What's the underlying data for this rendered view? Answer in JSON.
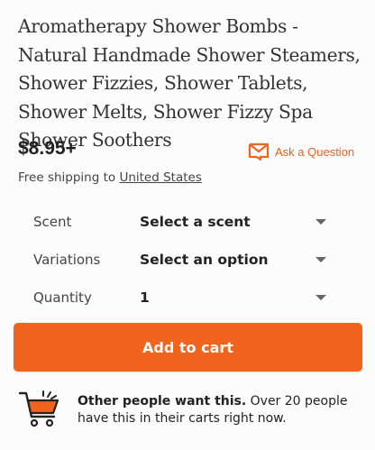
{
  "product": {
    "title": "Aromatherapy Shower Bombs - Natural Handmade Shower Steamers, Shower Fizzies, Shower Tablets, Shower Melts, Shower Fizzy Spa Shower Soothers",
    "price": "$8.95+",
    "ask_label": "Ask a Question"
  },
  "shipping": {
    "prefix": "Free shipping to ",
    "destination": "United States"
  },
  "options": [
    {
      "label": "Scent",
      "value": "Select a scent"
    },
    {
      "label": "Variations",
      "value": "Select an option"
    },
    {
      "label": "Quantity",
      "value": "1"
    }
  ],
  "cart": {
    "button_label": "Add to cart"
  },
  "social_proof": {
    "bold": "Other people want this.",
    "text": " Over 20 people have this in their carts right now."
  },
  "colors": {
    "accent": "#f1641e",
    "ask_link": "#e5621e",
    "icon_orange": "#f1641e"
  },
  "icons": {
    "ask": "envelope-icon",
    "social": "shopping-cart-icon",
    "select": "caret-down-icon"
  }
}
